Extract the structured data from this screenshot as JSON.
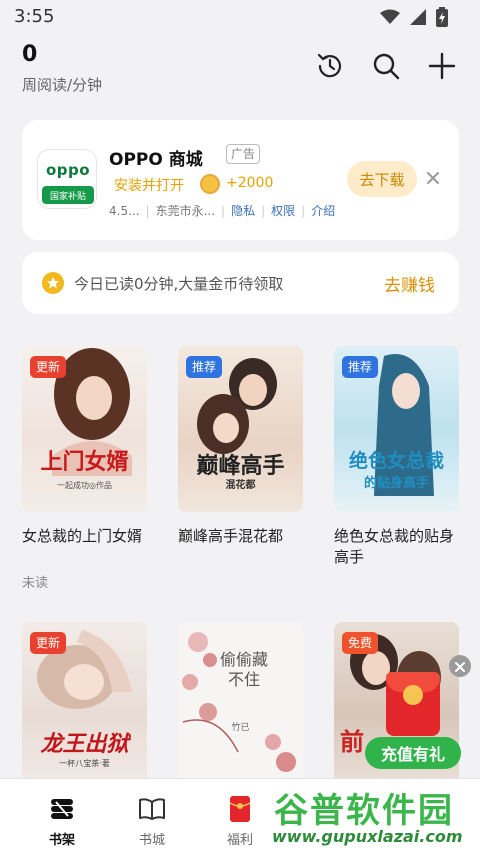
{
  "status_bar": {
    "time": "3:55"
  },
  "header": {
    "weekly_minutes": "0",
    "weekly_label": "周阅读/分钟"
  },
  "ad": {
    "title": "OPPO 商城",
    "tag": "广告",
    "logo_text": "oppo",
    "logo_sub": "国家补贴",
    "install_text": "安装并打开",
    "reward": "+2000",
    "rating": "4.5...",
    "developer": "东莞市永...",
    "links": [
      "隐私",
      "权限",
      "介绍"
    ],
    "download_label": "去下载"
  },
  "reading_prompt": {
    "text": "今日已读0分钟,大量金币待领取",
    "action": "去赚钱"
  },
  "books": [
    {
      "badge": "更新",
      "badge_color": "red",
      "title": "女总裁的上门女婿",
      "status": "未读",
      "cover_text": "上门女婿",
      "cover_sub": "一起成功◎作品"
    },
    {
      "badge": "推荐",
      "badge_color": "blue",
      "title": "巅峰高手混花都",
      "status": "",
      "cover_text": "巅峰高手",
      "cover_sub": "混花都"
    },
    {
      "badge": "推荐",
      "badge_color": "blue",
      "title": "绝色女总裁的贴身高手",
      "status": "",
      "cover_text": "绝色女总裁",
      "cover_sub": "的贴身高手"
    },
    {
      "badge": "更新",
      "badge_color": "red",
      "title": "",
      "status": "",
      "cover_text": "龙王出狱",
      "cover_sub": "一杯八宝茶·著"
    },
    {
      "badge": "",
      "badge_color": "",
      "title": "",
      "status": "",
      "cover_text": "偷偷藏不住",
      "cover_sub": "竹已"
    },
    {
      "badge": "免费",
      "badge_color": "red",
      "title": "",
      "status": "",
      "cover_text": "前",
      "cover_sub": ""
    }
  ],
  "gift": {
    "label": "充值有礼"
  },
  "nav": [
    {
      "label": "书架",
      "active": true
    },
    {
      "label": "书城",
      "active": false
    },
    {
      "label": "福利",
      "active": false
    }
  ],
  "watermark": {
    "cn": "谷普软件园",
    "url": "www.gupuxlazai.com"
  },
  "colors": {
    "accent": "#d9900a",
    "badge_red": "#e8412f",
    "badge_blue": "#2f73e0",
    "gift_green": "#2fb34a"
  }
}
